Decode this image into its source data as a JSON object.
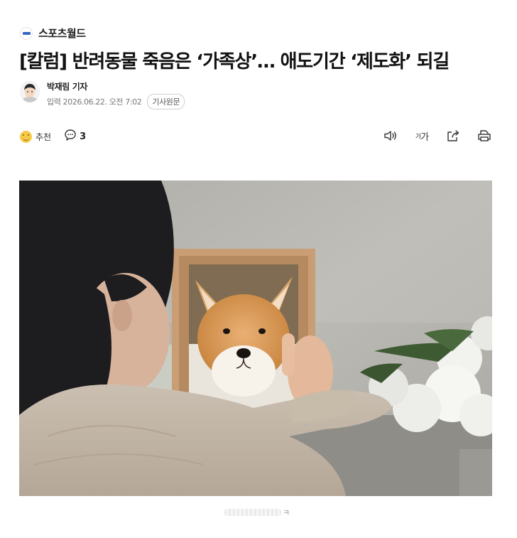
{
  "press": {
    "name": "스포츠월드",
    "logo_icon": "sportsworld-logo"
  },
  "article": {
    "headline": "[칼럼] 반려동물 죽음은 ‘가족상’… 애도기간 ‘제도화’ 되길",
    "reporter": "박재림 기자",
    "published": "입력 2026.06.22. 오전 7:02",
    "origin_button": "기사원문"
  },
  "toolbar": {
    "recommend_label": "추천",
    "comment_count": "3",
    "font_size_label_small": "가",
    "font_size_label_large": "가",
    "icons": [
      "smile-icon",
      "comment-icon",
      "speaker-icon",
      "font-size-icon",
      "share-icon",
      "print-icon"
    ]
  },
  "caption": {
    "tail": "ㅋ"
  },
  "colors": {
    "accent_blue": "#3c64c8",
    "recommend_yellow": "#f7c948"
  }
}
